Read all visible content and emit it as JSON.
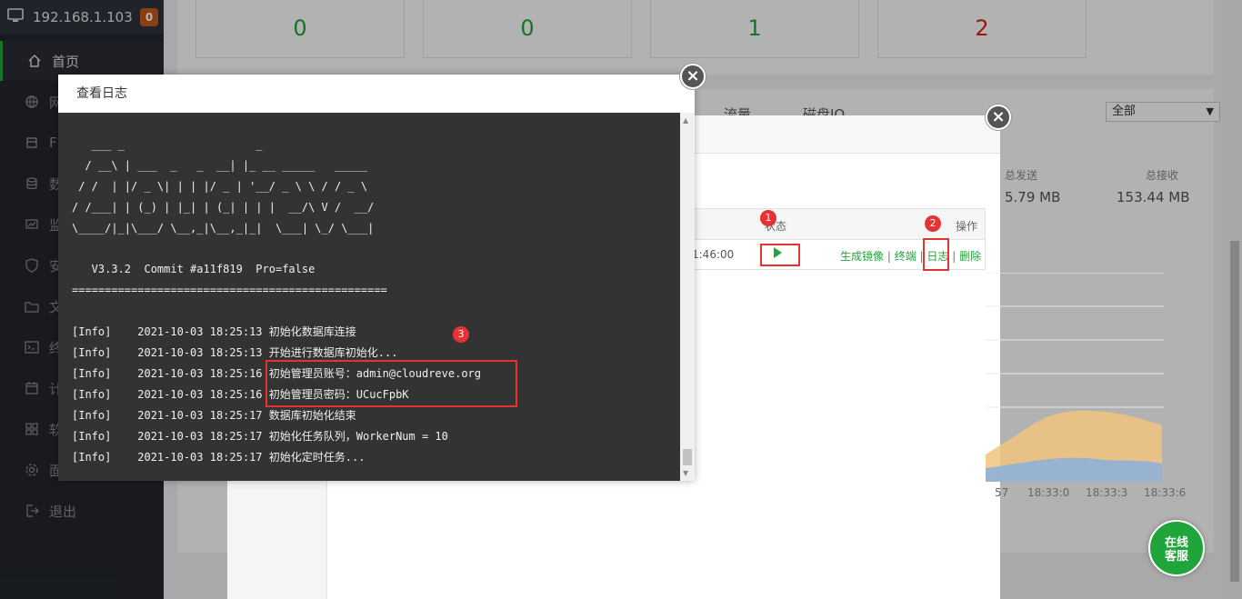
{
  "sidebar": {
    "host_ip": "192.168.1.103",
    "badge": "0",
    "items": [
      {
        "label": "首页",
        "icon": "home-icon"
      },
      {
        "label": "网",
        "icon": "globe-icon"
      },
      {
        "label": "F",
        "icon": "ftp-icon"
      },
      {
        "label": "数",
        "icon": "database-icon"
      },
      {
        "label": "监",
        "icon": "monitor-icon"
      },
      {
        "label": "安",
        "icon": "shield-icon"
      },
      {
        "label": "文",
        "icon": "folder-icon"
      },
      {
        "label": "终",
        "icon": "terminal-icon"
      },
      {
        "label": "计",
        "icon": "calendar-icon"
      },
      {
        "label": "软",
        "icon": "apps-icon"
      },
      {
        "label": "面",
        "icon": "gear-icon"
      },
      {
        "label": "退出",
        "icon": "logout-icon"
      }
    ]
  },
  "stats": [
    "0",
    "0",
    "1",
    "2"
  ],
  "panel": {
    "tab_traffic": "流量",
    "tab_disk": "磁盘IO",
    "select_value": "全部",
    "total_send_label": "总发送",
    "total_send_value": "5.79 MB",
    "total_recv_label": "总接收",
    "total_recv_value": "153.44 MB",
    "x_ticks": [
      "57",
      "18:33:0",
      "18:33:3",
      "18:33:6"
    ]
  },
  "container_table": {
    "col_status": "状态",
    "col_ops": "操作",
    "time": "1:46:00",
    "ops": [
      "生成镜像",
      "终端",
      "日志",
      "删除"
    ]
  },
  "log_dialog": {
    "title": "查看日志",
    "ascii_art": "   ___ _                    _\n  / __\\ | ___  _   _  __| |_ __ _____   _____\n / /  | |/ _ \\| | | |/ _ | '__/ _ \\ \\ / / _ \\\n/ /___| | (_) | |_| | (_| | | |  __/\\ V /  __/\n\\____/|_|\\___/ \\__,_|\\__,_|_|  \\___| \\_/ \\___|",
    "version_line": "   V3.3.2  Commit #a11f819  Pro=false",
    "separator": "================================================",
    "lines": [
      "[Info]    2021-10-03 18:25:13 初始化数据库连接",
      "[Info]    2021-10-03 18:25:13 开始进行数据库初始化...",
      "[Info]    2021-10-03 18:25:16 初始管理员账号：admin@cloudreve.org",
      "[Info]    2021-10-03 18:25:16 初始管理员密码：UCucFpbK",
      "[Info]    2021-10-03 18:25:17 数据库初始化结束",
      "[Info]    2021-10-03 18:25:17 初始化任务队列，WorkerNum = 10",
      "[Info]    2021-10-03 18:25:17 初始化定时任务..."
    ]
  },
  "markers": [
    "1",
    "2",
    "3"
  ],
  "service_button": {
    "line1": "在线",
    "line2": "客服"
  },
  "colors": {
    "accent": "#20a53a",
    "highlight": "#e53333",
    "badge": "#c8591c"
  }
}
